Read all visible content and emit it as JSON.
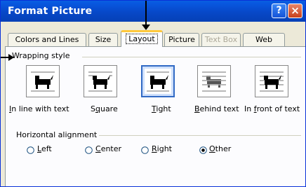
{
  "window": {
    "title": "Format Picture",
    "help_glyph": "?",
    "close_glyph": "×"
  },
  "tabs": [
    {
      "label": "Colors and Lines",
      "state": "normal"
    },
    {
      "label": "Size",
      "state": "normal"
    },
    {
      "label": "Layout",
      "state": "active"
    },
    {
      "label": "Picture",
      "state": "normal"
    },
    {
      "label": "Text Box",
      "state": "disabled"
    },
    {
      "label": "Web",
      "state": "normal"
    }
  ],
  "wrapping": {
    "heading": "Wrapping style",
    "options": [
      {
        "label_ul": "I",
        "label_rest": "n line with text",
        "selected": false
      },
      {
        "label_pre": "S",
        "label_ul": "q",
        "label_rest": "uare",
        "selected": false
      },
      {
        "label_ul": "T",
        "label_rest": "ight",
        "selected": true
      },
      {
        "label_ul": "B",
        "label_rest": "ehind text",
        "selected": false
      },
      {
        "label_pre": "In ",
        "label_ul": "f",
        "label_rest": "ront of text",
        "selected": false
      }
    ]
  },
  "alignment": {
    "heading": "Horizontal alignment",
    "options": [
      {
        "label_ul": "L",
        "label_rest": "eft",
        "checked": false
      },
      {
        "label_ul": "C",
        "label_rest": "enter",
        "checked": false
      },
      {
        "label_ul": "R",
        "label_rest": "ight",
        "checked": false
      },
      {
        "label_ul": "O",
        "label_rest": "ther",
        "checked": true
      }
    ]
  },
  "colors": {
    "accent": "#316ac5",
    "titlebar": "#0748c8",
    "tab_highlight": "#ffc83c"
  }
}
